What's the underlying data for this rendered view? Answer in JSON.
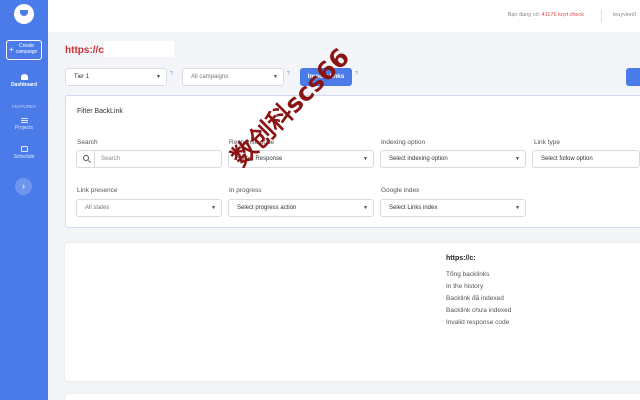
{
  "sidebar": {
    "create_label": "Create campaign",
    "dashboard_label": "Dashboard",
    "features_label": "FEATURES",
    "projects_label": "Projects",
    "schedule_label": "Schedule",
    "expand_glyph": "›",
    "accent": "#4a7be8"
  },
  "header": {
    "credit_label": "Bạn đang có:",
    "credit_amount": "41176 lượt check",
    "user_name": "leuyvien0"
  },
  "page": {
    "url": "https://c"
  },
  "toolbar": {
    "tier_value": "Tier 1",
    "campaign_placeholder": "All campaigns",
    "help_glyph": "?",
    "import_label": "Import links"
  },
  "filter": {
    "title": "Filter BackLink",
    "search_label": "Search",
    "search_placeholder": "Search",
    "response_label": "Response code",
    "response_value": "Select Response",
    "indexing_label": "Indexing option",
    "indexing_value": "Select indexing option",
    "linktype_label": "Link type",
    "linktype_value": "Select follow option",
    "presence_label": "Link presence",
    "presence_value": "All states",
    "progress_label": "In progress",
    "progress_value": "Select progress action",
    "google_label": "Google index",
    "google_value": "Select Links index"
  },
  "stats": {
    "title": "https://c:",
    "items": [
      "Tổng backlinks",
      "In the history",
      "Backlink đã indexed",
      "Backlink chưa indexed",
      "Invalid response code"
    ]
  },
  "watermark": "数创科scs66"
}
